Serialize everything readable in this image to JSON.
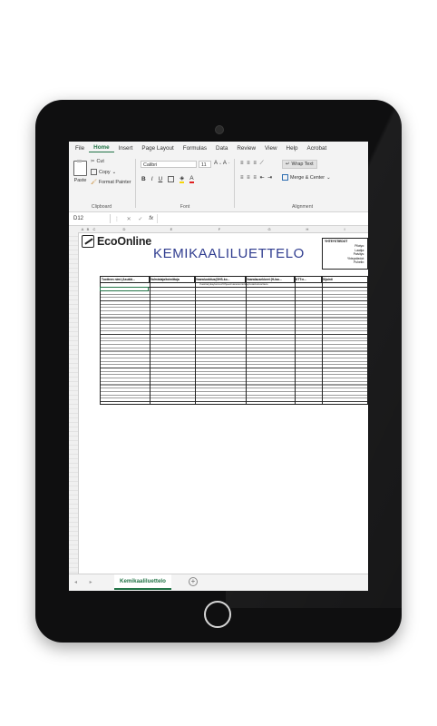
{
  "ribbon": {
    "tabs": [
      "File",
      "Home",
      "Insert",
      "Page Layout",
      "Formulas",
      "Data",
      "Review",
      "View",
      "Help",
      "Acrobat"
    ],
    "active_tab": "Home",
    "clipboard": {
      "paste": "Paste",
      "cut": "Cut",
      "copy": "Copy",
      "format_painter": "Format Painter",
      "label": "Clipboard"
    },
    "font": {
      "name": "Calibri",
      "size": "11",
      "label": "Font",
      "bold": "B",
      "italic": "I",
      "underline": "U"
    },
    "alignment": {
      "wrap_text": "Wrap Text",
      "merge_center": "Merge & Center",
      "label": "Alignment"
    }
  },
  "formula_bar": {
    "cell_ref": "D12",
    "fx": "fx",
    "value": ""
  },
  "sheet": {
    "brand": "EcoOnline",
    "title": "KEMIKAALILUETTELO",
    "info_box": {
      "heading": "YHTEYSTIEDOT",
      "lines": [
        "Pilotyo:",
        "Laatija:",
        "Paivitys:",
        "Yhteystiedot:",
        "Puhelin:"
      ]
    },
    "columns": [
      "Tuotteen nimi (Asukki...",
      "Valmistaja/toimittaja",
      "Vaaraluokitus(GHS-ko...",
      "Vaaralausekkeet (H-lau...",
      "KTT:n...",
      "Sijainti"
    ],
    "subheader": "Kasittelykaytannot/Ohjeet/varastointi/kayttotarkoitus/tieto"
  },
  "sheet_tabs": {
    "active": "Kemikaaliluettelo",
    "add": "+"
  }
}
